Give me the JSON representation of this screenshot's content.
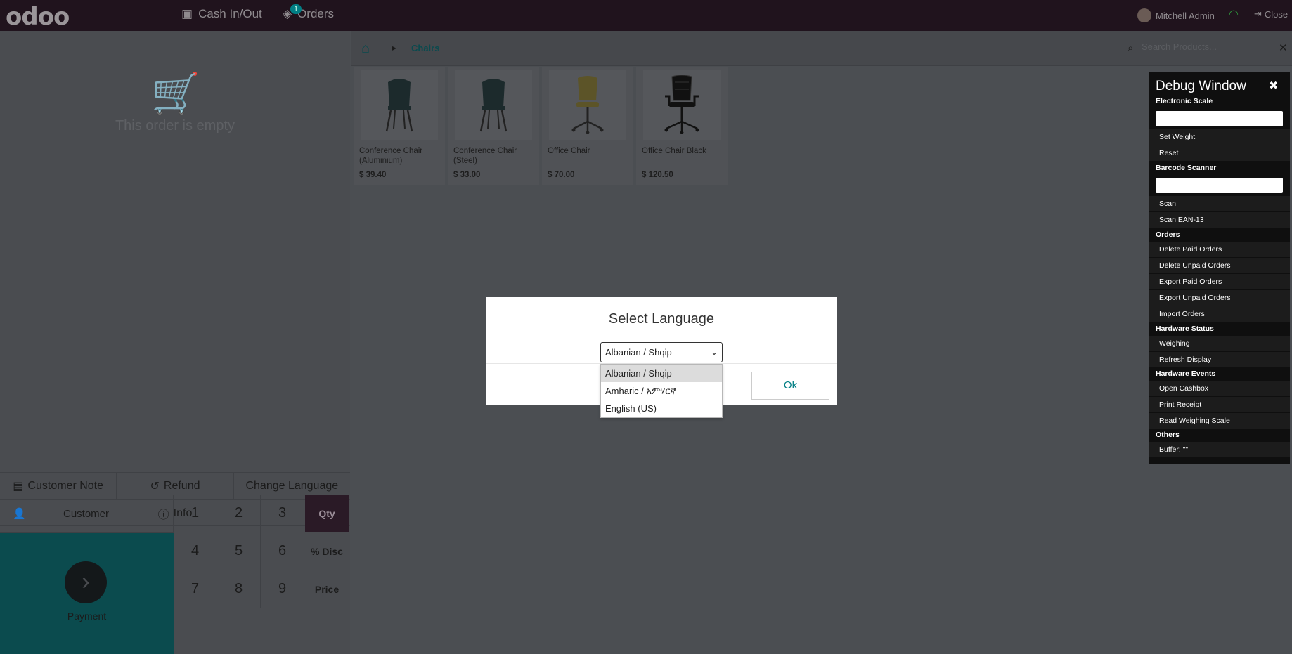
{
  "topbar": {
    "logo": "odoo",
    "cash_label": "Cash In/Out",
    "orders_label": "Orders",
    "orders_count": "1",
    "user_name": "Mitchell Admin",
    "close_label": "Close"
  },
  "order": {
    "empty_text": "This order is empty"
  },
  "controls": {
    "customer_note": "Customer Note",
    "refund": "Refund",
    "change_language": "Change Language",
    "info": "Info"
  },
  "actionpad": {
    "customer": "Customer",
    "payment": "Payment"
  },
  "numpad": {
    "keys": [
      "1",
      "2",
      "3",
      "4",
      "5",
      "6",
      "7",
      "8",
      "9"
    ],
    "modes": [
      "Qty",
      "% Disc",
      "Price"
    ]
  },
  "breadcrumb": {
    "category": "Chairs"
  },
  "search": {
    "placeholder": "Search Products..."
  },
  "products": [
    {
      "name": "Conference Chair (Aluminium)",
      "price": "$ 39.40"
    },
    {
      "name": "Conference Chair (Steel)",
      "price": "$ 33.00"
    },
    {
      "name": "Office Chair",
      "price": "$ 70.00"
    },
    {
      "name": "Office Chair Black",
      "price": "$ 120.50"
    }
  ],
  "modal": {
    "title": "Select Language",
    "selected": "Albanian / Shqip",
    "ok_label": "Ok",
    "options": [
      "Albanian / Shqip",
      "Amharic / አምሃርኛ",
      "English (US)"
    ]
  },
  "debug": {
    "title": "Debug Window",
    "sections": {
      "scale": "Electronic Scale",
      "barcode": "Barcode Scanner",
      "orders": "Orders",
      "hardware_status": "Hardware Status",
      "hardware_events": "Hardware Events",
      "others": "Others"
    },
    "buttons": {
      "set_weight": "Set Weight",
      "reset": "Reset",
      "scan": "Scan",
      "scan_ean13": "Scan EAN-13",
      "delete_paid": "Delete Paid Orders",
      "delete_unpaid": "Delete Unpaid Orders",
      "export_paid": "Export Paid Orders",
      "export_unpaid": "Export Unpaid Orders",
      "import_orders": "Import Orders",
      "weighing": "Weighing",
      "refresh_display": "Refresh Display",
      "open_cashbox": "Open Cashbox",
      "print_receipt": "Print Receipt",
      "read_scale": "Read Weighing Scale",
      "buffer": "Buffer: \"\""
    }
  },
  "colors": {
    "brand_dark": "#20131d",
    "accent_teal": "#017e84"
  }
}
